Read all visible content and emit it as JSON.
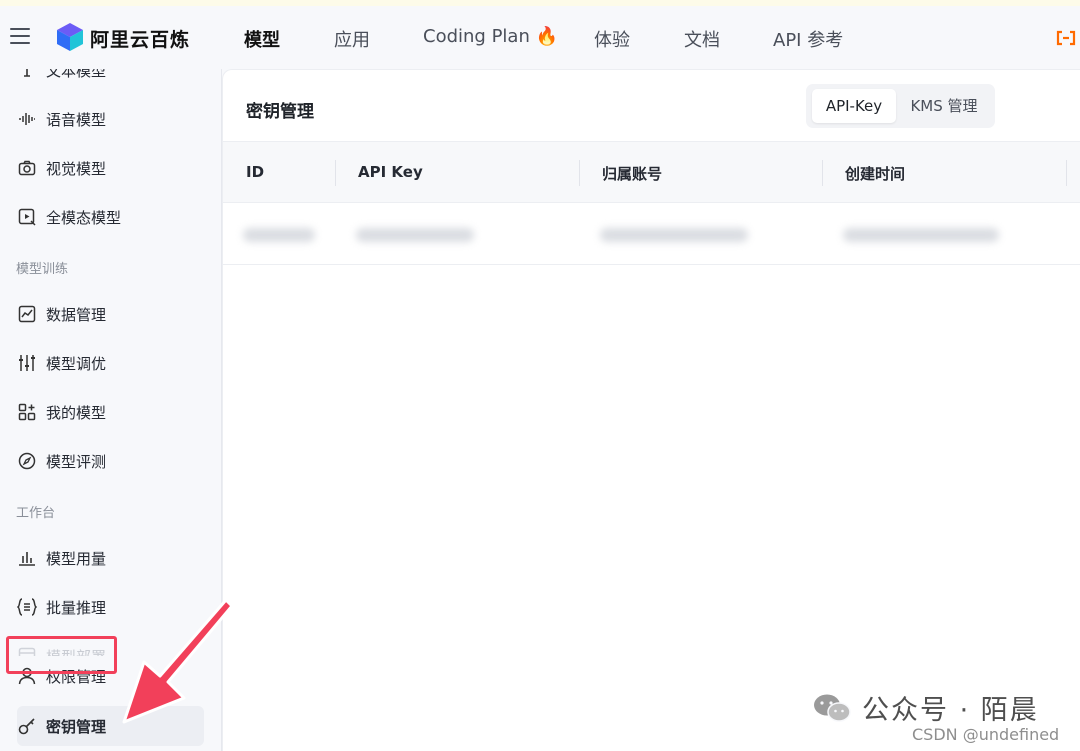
{
  "header": {
    "brand": "阿里云百炼",
    "nav": [
      "模型",
      "应用",
      "Coding Plan 🔥",
      "体验",
      "文档",
      "API 参考"
    ]
  },
  "sidebar": {
    "partial_top": "文本模型",
    "items_models": [
      "语音模型",
      "视觉模型",
      "全模态模型"
    ],
    "group_training": "模型训练",
    "items_training": [
      "数据管理",
      "模型调优",
      "我的模型",
      "模型评测"
    ],
    "group_workbench": "工作台",
    "items_workbench": [
      "模型用量",
      "批量推理"
    ],
    "partial_bottom": "模型部署",
    "items_bottom": [
      "权限管理",
      "密钥管理"
    ]
  },
  "panel": {
    "title": "密钥管理",
    "tabs": [
      "API-Key",
      "KMS 管理"
    ],
    "columns": [
      "ID",
      "API Key",
      "归属账号",
      "创建时间"
    ]
  },
  "watermark": {
    "text": "公众号 · 陌晨",
    "source": "CSDN @undefined"
  },
  "colors": {
    "accent_highlight": "#f2405a",
    "brand_orange": "#ff6a00"
  }
}
